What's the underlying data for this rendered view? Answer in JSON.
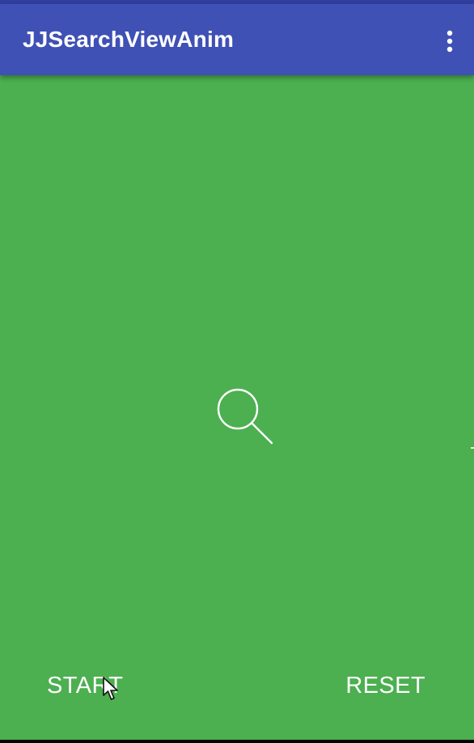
{
  "app_bar": {
    "title": "JJSearchViewAnim",
    "menu_icon": "more-vert-icon"
  },
  "main": {
    "animation_icon": "search-icon"
  },
  "buttons": {
    "start_label": "START",
    "reset_label": "RESET"
  },
  "colors": {
    "primary": "#3f51b5",
    "primary_dark": "#303f9f",
    "background": "#4caf50",
    "icon_stroke": "#ffffff",
    "text": "#ffffff"
  }
}
